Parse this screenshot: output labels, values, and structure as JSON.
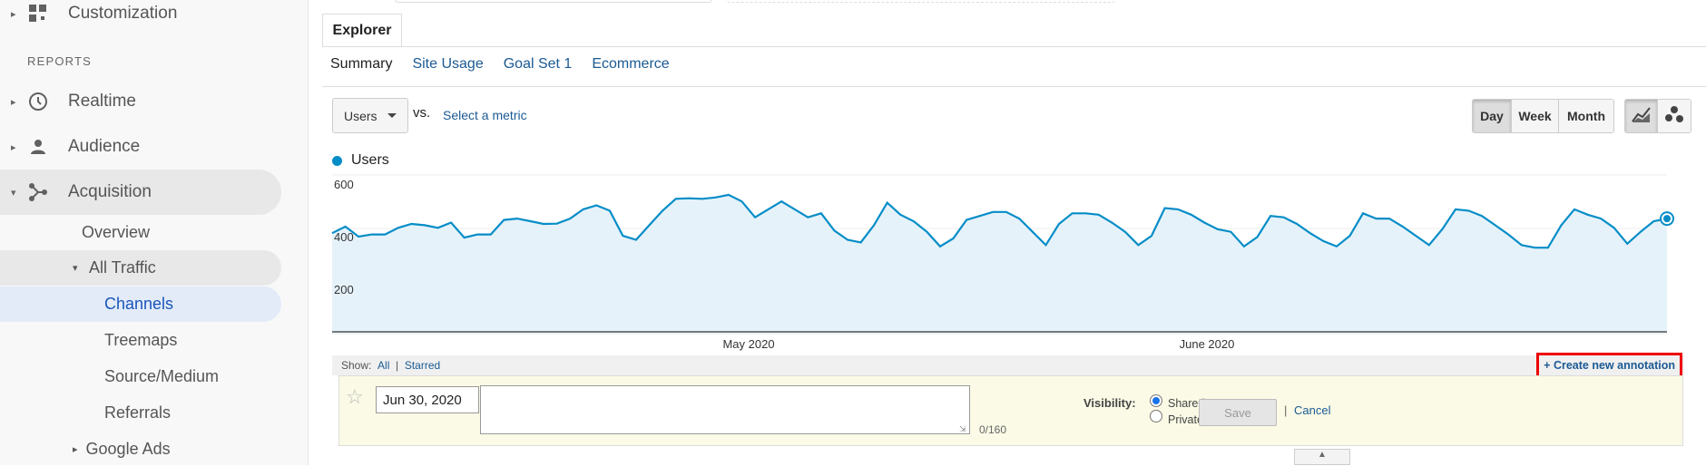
{
  "sidebar": {
    "customization": "Customization",
    "reports_heading": "REPORTS",
    "realtime": "Realtime",
    "audience": "Audience",
    "acquisition": "Acquisition",
    "overview": "Overview",
    "all_traffic": "All Traffic",
    "channels": "Channels",
    "treemaps": "Treemaps",
    "source_medium": "Source/Medium",
    "referrals": "Referrals",
    "google_ads": "Google Ads"
  },
  "main": {
    "tab": "Explorer",
    "subtabs": [
      "Summary",
      "Site Usage",
      "Goal Set 1",
      "Ecommerce"
    ],
    "metric": "Users",
    "vs": "vs.",
    "select_metric": "Select a metric",
    "period": [
      "Day",
      "Week",
      "Month"
    ],
    "active_period": "Day",
    "chart_types": [
      "line-chart-icon",
      "motion-chart-icon"
    ]
  },
  "chart_data": {
    "type": "area",
    "series": [
      {
        "name": "Users",
        "color": "#058dc7",
        "values": [
          380,
          405,
          367,
          375,
          375,
          400,
          415,
          410,
          400,
          420,
          363,
          375,
          375,
          430,
          435,
          425,
          415,
          416,
          435,
          470,
          485,
          465,
          370,
          355,
          410,
          465,
          510,
          512,
          510,
          515,
          525,
          500,
          440,
          470,
          500,
          470,
          440,
          455,
          390,
          355,
          345,
          410,
          495,
          450,
          425,
          385,
          330,
          360,
          430,
          445,
          460,
          460,
          435,
          385,
          335,
          415,
          455,
          455,
          450,
          420,
          385,
          335,
          370,
          475,
          470,
          450,
          420,
          395,
          385,
          330,
          365,
          445,
          440,
          415,
          380,
          350,
          330,
          370,
          455,
          435,
          435,
          405,
          370,
          335,
          395,
          470,
          465,
          445,
          410,
          375,
          335,
          325,
          325,
          410,
          470,
          450,
          435,
          400,
          340,
          385,
          425,
          435
        ]
      }
    ],
    "x_labels": [
      "May 2020",
      "June 2020"
    ],
    "y_ticks": [
      200,
      400,
      600
    ],
    "ylim": [
      0,
      600
    ]
  },
  "annotations": {
    "show_label": "Show:",
    "all": "All",
    "separator": "|",
    "starred": "Starred",
    "create": "+ Create new annotation",
    "date_value": "Jun 30, 2020",
    "counter": "0/160",
    "visibility_label": "Visibility:",
    "shared": "Shared",
    "private": "Private",
    "save": "Save",
    "cancel": "Cancel"
  }
}
